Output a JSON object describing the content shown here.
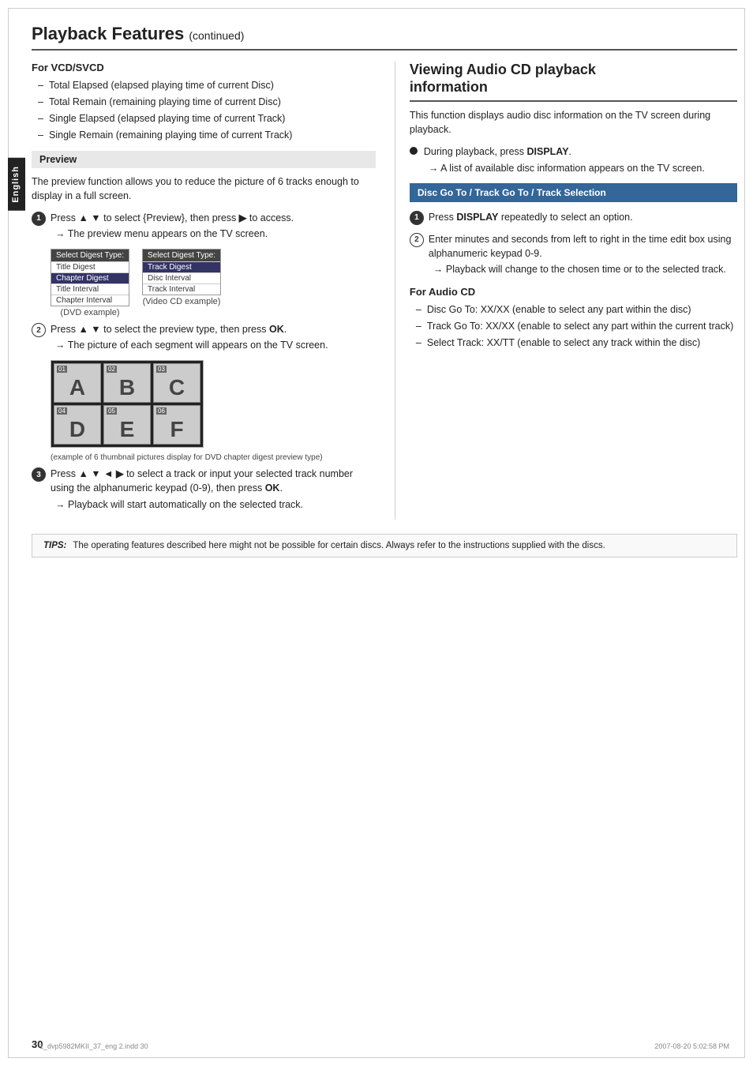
{
  "page": {
    "title": "Playback Features",
    "title_continued": "(continued)",
    "page_number": "30",
    "footer_file": "1_dvp5982MKII_37_eng 2.indd  30",
    "footer_date": "2007-08-20  5:02:58 PM"
  },
  "sidebar": {
    "label": "English"
  },
  "left_col": {
    "vcd_section": {
      "heading": "For VCD/SVCD",
      "items": [
        "Total Elapsed (elapsed playing time of current Disc)",
        "Total Remain (remaining playing time of current Disc)",
        "Single Elapsed (elapsed playing time of current Track)",
        "Single Remain (remaining playing time of current Track)"
      ]
    },
    "preview_section": {
      "label": "Preview",
      "intro": "The preview function allows you to reduce the picture of 6 tracks enough to display in a full screen.",
      "steps": [
        {
          "number": "1",
          "text": "Press ▲ ▼ to select {Preview}, then press ▶ to access.",
          "note": "The preview menu appears on the TV screen."
        },
        {
          "number": "2",
          "text": "Press ▲ ▼ to select the preview type, then press OK.",
          "note": "The picture of each segment will appears on the TV screen."
        },
        {
          "number": "3",
          "text": "Press ▲ ▼ ◄ ▶ to select a track or input your selected track number using the alphanumeric keypad (0-9), then press OK.",
          "note": "Playback will start automatically on the selected track."
        }
      ],
      "dvd_example_label": "(DVD example)",
      "vcd_example_label": "(Video CD example)",
      "dvd_digest_header": "Select Digest Type:",
      "dvd_digest_items": [
        {
          "text": "Title Digest",
          "selected": false
        },
        {
          "text": "Chapter Digest",
          "selected": true
        },
        {
          "text": "Title Interval",
          "selected": false
        },
        {
          "text": "Chapter Interval",
          "selected": false
        }
      ],
      "vcd_digest_header": "Select Digest Type:",
      "vcd_digest_items": [
        {
          "text": "Track Digest",
          "selected": true
        },
        {
          "text": "Disc Interval",
          "selected": false
        },
        {
          "text": "Track Interval",
          "selected": false
        }
      ],
      "thumbnail_cells": [
        {
          "number": "01",
          "letter": "A"
        },
        {
          "number": "02",
          "letter": "B"
        },
        {
          "number": "03",
          "letter": "C"
        },
        {
          "number": "04",
          "letter": "D"
        },
        {
          "number": "05",
          "letter": "E"
        },
        {
          "number": "06",
          "letter": "F"
        }
      ],
      "thumb_caption": "(example of 6 thumbnail pictures display for DVD chapter digest preview type)"
    }
  },
  "right_col": {
    "section_title_line1": "Viewing Audio CD playback",
    "section_title_line2": "information",
    "intro": "This function displays audio disc information on the TV screen during playback.",
    "step1": {
      "bullet": "●",
      "text": "During playback, press DISPLAY.",
      "note": "A list of available disc information appears on the TV screen."
    },
    "disc_goto_box": {
      "label": "Disc Go To / Track Go To / Track Selection"
    },
    "steps": [
      {
        "number": "1",
        "text": "Press DISPLAY repeatedly to select an option."
      },
      {
        "number": "2",
        "text": "Enter minutes and seconds from left to right in the time edit box using alphanumeric keypad 0-9.",
        "note": "Playback will change to the chosen time or to the selected track."
      }
    ],
    "audio_cd_section": {
      "heading": "For Audio CD",
      "items": [
        "Disc Go To: XX/XX (enable to select any part within the disc)",
        "Track Go To: XX/XX (enable to select any part within the current track)",
        "Select Track: XX/TT (enable to select any track within the disc)"
      ]
    }
  },
  "tips": {
    "label": "TIPS:",
    "text": "The operating features described here might not be possible for certain discs. Always refer to the instructions supplied with the discs."
  }
}
